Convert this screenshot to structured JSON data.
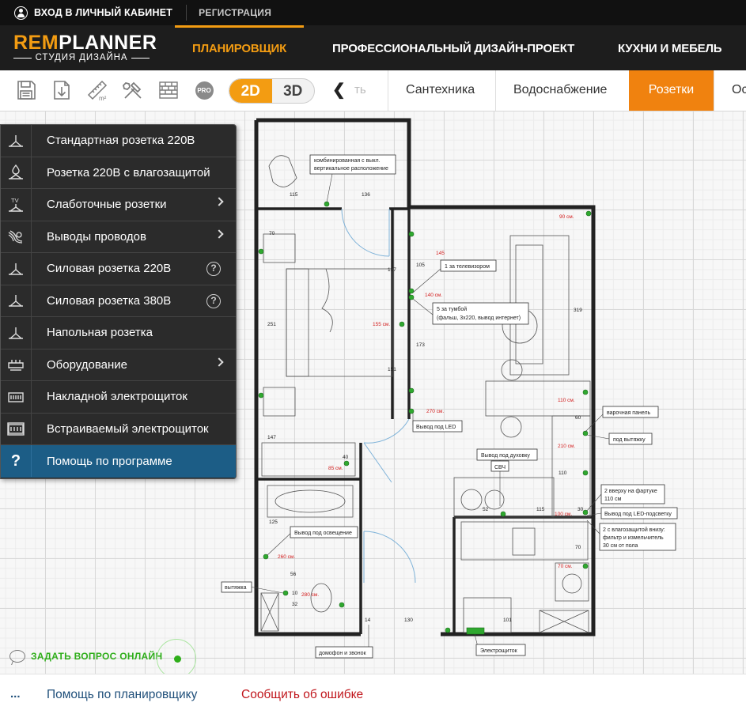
{
  "topbar": {
    "login_label": "ВХОД В ЛИЧНЫЙ КАБИНЕТ",
    "register_label": "РЕГИСТРАЦИЯ"
  },
  "logo": {
    "rem": "REM",
    "planner": "PLANNER",
    "subtitle": "СТУДИЯ ДИЗАЙНА"
  },
  "nav": {
    "items": [
      {
        "label": "ПЛАНИРОВЩИК",
        "active": true
      },
      {
        "label": "ПРОФЕССИОНАЛЬНЫЙ ДИЗАЙН-ПРОЕКТ",
        "active": false
      },
      {
        "label": "КУХНИ И МЕБЕЛЬ",
        "active": false
      }
    ]
  },
  "toolbar": {
    "tools": [
      "save-icon",
      "download-icon",
      "area-ruler-icon",
      "tools-icon",
      "brick-wall-icon",
      "pro-icon"
    ],
    "pro_label": "PRO",
    "mode_2d": "2D",
    "mode_3d": "3D",
    "prev_ghost": "ть",
    "tabs": [
      {
        "label": "Сантехника",
        "active": false
      },
      {
        "label": "Водоснабжение",
        "active": false
      },
      {
        "label": "Розетки",
        "active": true
      },
      {
        "label": "Ос",
        "active": false
      }
    ]
  },
  "menu": {
    "items": [
      {
        "label": "Стандартная розетка 220В",
        "icon": "socket-icon",
        "has_submenu": false,
        "has_help": false
      },
      {
        "label": "Розетка 220В с влагозащитой",
        "icon": "waterproof-socket-icon",
        "has_submenu": false,
        "has_help": false
      },
      {
        "label": "Слаботочные розетки",
        "icon": "tv-socket-icon",
        "has_submenu": true,
        "has_help": false
      },
      {
        "label": "Выводы проводов",
        "icon": "wire-output-icon",
        "has_submenu": true,
        "has_help": false
      },
      {
        "label": "Силовая розетка 220В",
        "icon": "power-socket-icon",
        "has_submenu": false,
        "has_help": true
      },
      {
        "label": "Силовая розетка 380В",
        "icon": "power-socket-icon",
        "has_submenu": false,
        "has_help": true
      },
      {
        "label": "Напольная розетка",
        "icon": "floor-socket-icon",
        "has_submenu": false,
        "has_help": false
      },
      {
        "label": "Оборудование",
        "icon": "equipment-icon",
        "has_submenu": true,
        "has_help": false
      },
      {
        "label": "Накладной электрощиток",
        "icon": "surface-panel-icon",
        "has_submenu": false,
        "has_help": false
      },
      {
        "label": "Встраиваемый электрощиток",
        "icon": "flush-panel-icon",
        "has_submenu": false,
        "has_help": false
      },
      {
        "label": "Помощь по программе",
        "icon": "question-icon",
        "has_submenu": false,
        "has_help": false,
        "active": true
      }
    ],
    "help_mark": "?"
  },
  "plan": {
    "labels": [
      "комбинированная с выкл.",
      "вертикальное расположение",
      "1 за телевизором",
      "5 за тумбой",
      "(фальш, 3х220, вывод интернет)",
      "Вывод под LED",
      "варочная панель",
      "под вытяжку",
      "Вывод под духовку",
      "СВЧ",
      "2 вверху на фартуке",
      "110 см",
      "Вывод под LED-подсветку",
      "2 с влагозащитой внизу:",
      "фильтр и измельчитель",
      "30 см от пола",
      "Вывод под освещение",
      "вытяжка",
      "домофон и звонок",
      "Электрощиток"
    ],
    "dimensions": [
      "115",
      "136",
      "70",
      "197",
      "251",
      "151",
      "173",
      "147",
      "40",
      "125",
      "130",
      "105",
      "319",
      "60",
      "52",
      "30",
      "101",
      "14",
      "10",
      "56",
      "32",
      "70",
      "115",
      "110"
    ],
    "red_dimensions": [
      "155 см.",
      "145",
      "140 см.",
      "270 см.",
      "210 см.",
      "110 см.",
      "85 см.",
      "260 см.",
      "280 см.",
      "90 см.",
      "70 см.",
      "100 см."
    ]
  },
  "chat": {
    "label": "ЗАДАТЬ ВОПРОС ОНЛАЙН"
  },
  "footer": {
    "dots": "...",
    "help_link": "Помощь по планировщику",
    "report_link": "Сообщить об ошибке"
  },
  "colors": {
    "accent": "#f39c12",
    "tab_active": "#f0820f",
    "menu_bg": "#2b2b2b",
    "menu_active": "#1c5d86",
    "chat_green": "#2fae1a",
    "footer_link": "#1f4f7a",
    "footer_error": "#c0151b"
  }
}
